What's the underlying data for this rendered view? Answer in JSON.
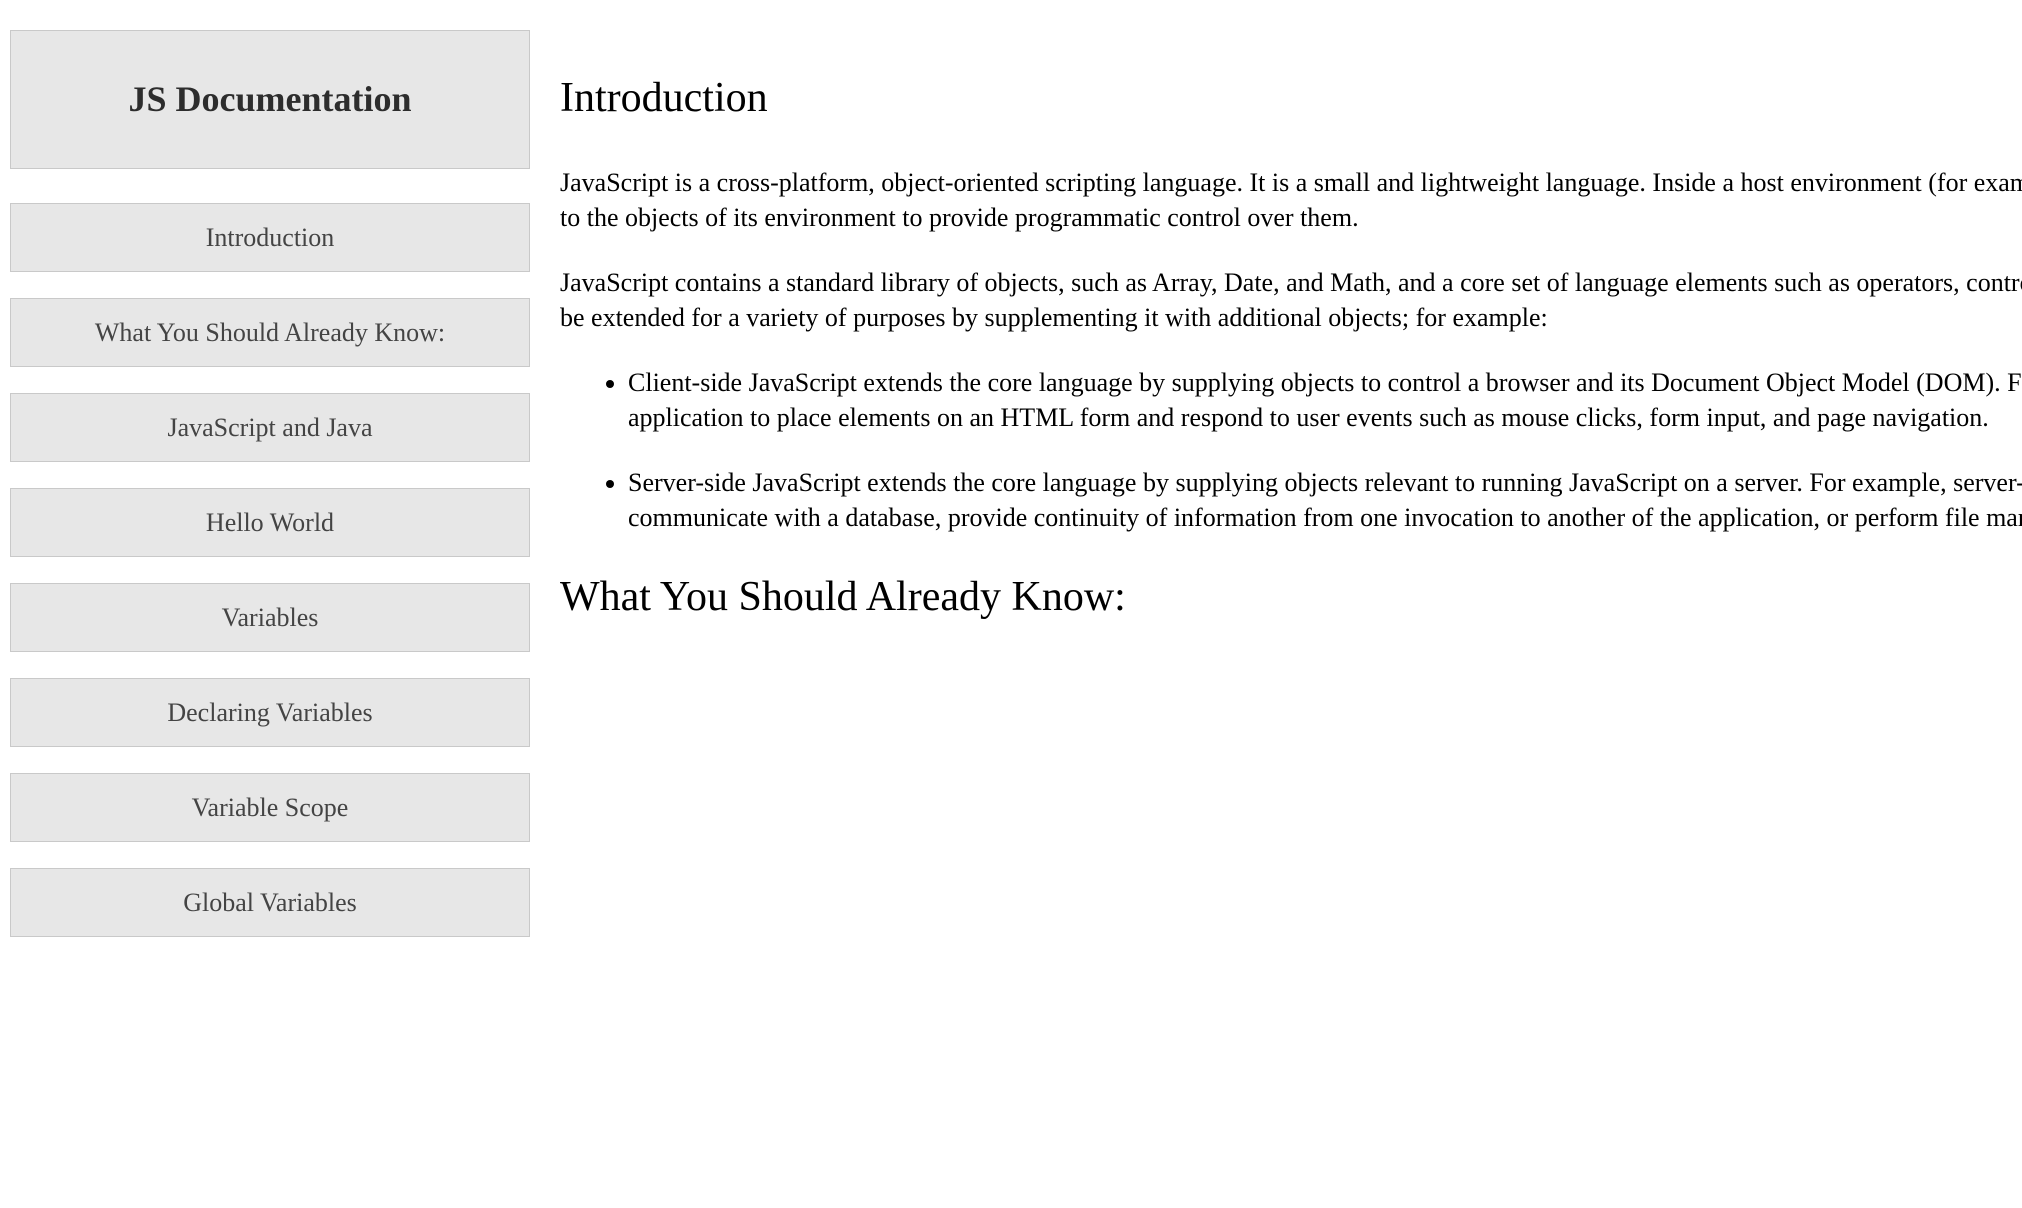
{
  "sidebar": {
    "title": "JS Documentation",
    "items": [
      "Introduction",
      "What You Should Already Know:",
      "JavaScript and Java",
      "Hello World",
      "Variables",
      "Declaring Variables",
      "Variable Scope",
      "Global Variables"
    ]
  },
  "content": {
    "intro": {
      "heading": "Introduction",
      "p1": "JavaScript is a cross-platform, object-oriented scripting language. It is a small and lightweight language. Inside a host environment (for example, a web browser), JavaScript can be connected to the objects of its environment to provide programmatic control over them.",
      "p2": "JavaScript contains a standard library of objects, such as Array, Date, and Math, and a core set of language elements such as operators, control structures, and statements. Core JavaScript can be extended for a variety of purposes by supplementing it with additional objects; for example:",
      "li1": "Client-side JavaScript extends the core language by supplying objects to control a browser and its Document Object Model (DOM). For example, client-side extensions allow an application to place elements on an HTML form and respond to user events such as mouse clicks, form input, and page navigation.",
      "li2": "Server-side JavaScript extends the core language by supplying objects relevant to running JavaScript on a server. For example, server-side extensions allow an application to communicate with a database, provide continuity of information from one invocation to another of the application, or perform file manipulations on a server."
    },
    "know": {
      "heading": "What You Should Already Know:"
    }
  }
}
